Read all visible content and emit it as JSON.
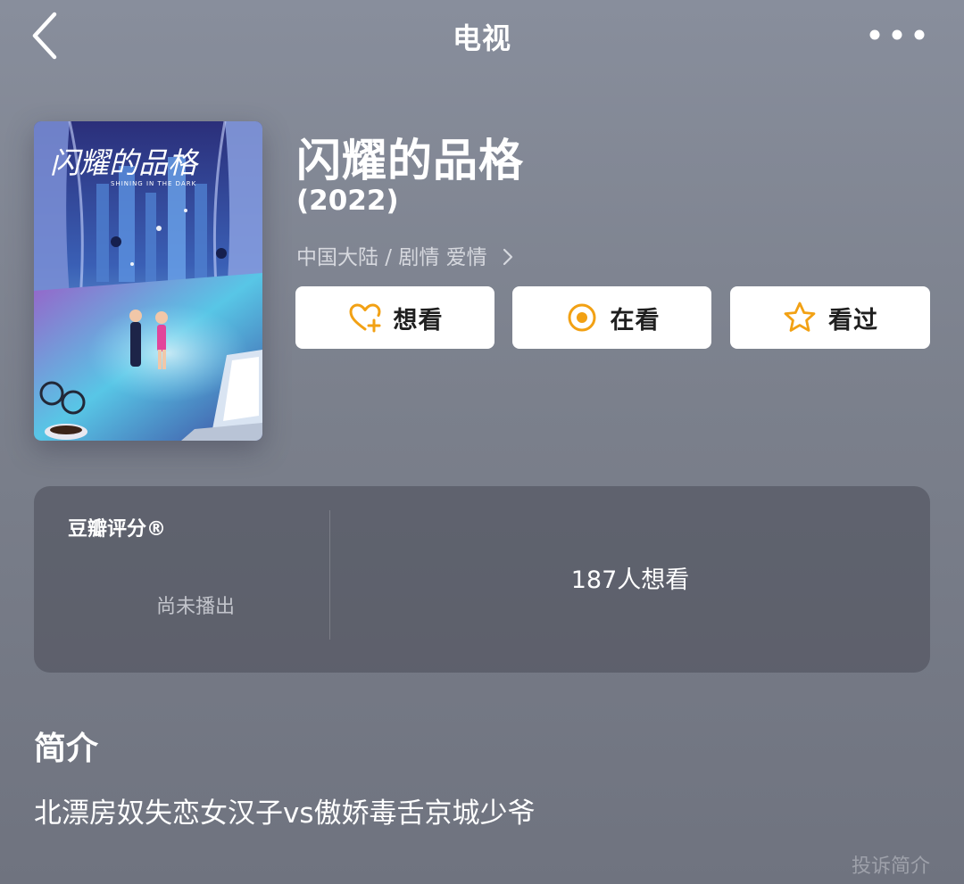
{
  "nav": {
    "title": "电视",
    "back_icon": "chevron-left-icon",
    "more_icon": "more-dots-icon"
  },
  "poster": {
    "calligraphy": "闪耀的品格",
    "subtitle": "SHINING IN THE DARK"
  },
  "subject": {
    "title": "闪耀的品格",
    "year": "(2022)",
    "meta": "中国大陆 / 剧情 爱情"
  },
  "actions": {
    "wish_label": "想看",
    "doing_label": "在看",
    "done_label": "看过",
    "accent_color": "#f2a114"
  },
  "rating": {
    "label": "豆瓣评分®",
    "status": "尚未播出",
    "wish_count": "187人想看"
  },
  "intro": {
    "heading": "简介",
    "text": "北漂房奴失恋女汉子vs傲娇毒舌京城少爷",
    "report_label": "投诉简介"
  }
}
